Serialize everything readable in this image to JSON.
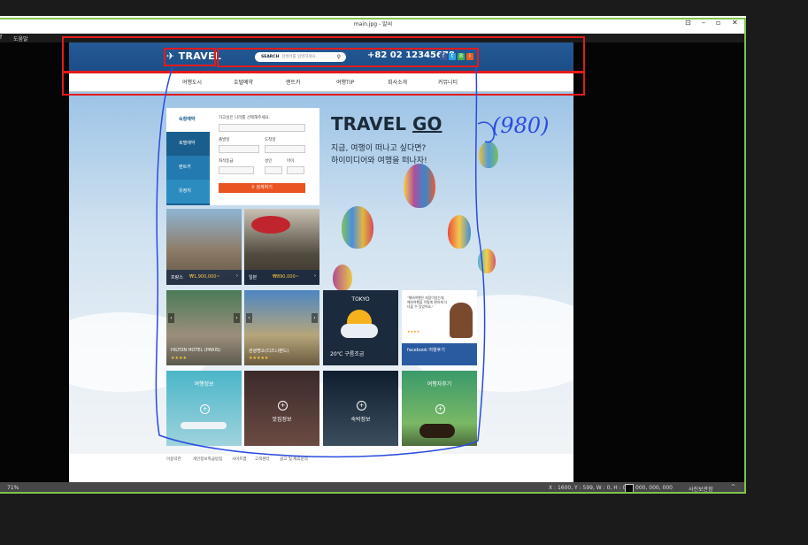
{
  "window": {
    "title": "main.jpg - 알씨",
    "menu_help": "도움말",
    "minimize": "–",
    "maximize": "▫",
    "close": "✕",
    "extra": "⊡"
  },
  "statusbar": {
    "zoom": "71%",
    "coords": "X : 1600, Y : 599, W : 0, H : 0",
    "color_value": "000, 000, 000",
    "right_button": "사진보관함"
  },
  "site": {
    "logo": "TRAVEL",
    "search_label": "SEARCH",
    "search_placeholder": "검색어를 입력하세요.",
    "phone": "+82 02 12345678",
    "nav": [
      "여행도시",
      "호텔예약",
      "렌트카",
      "여행TIP",
      "회사소개",
      "커뮤니티"
    ],
    "booking": {
      "tabs": [
        "숙항예약",
        "호텔예약",
        "렌트카",
        "유정지"
      ],
      "prompt": "가고싶은 나라를 선택해주세요.",
      "depart_label": "출발일",
      "arrive_label": "도착일",
      "seat_label": "좌석등급",
      "adult_label": "성인",
      "child_label": "아이",
      "search_button": "검색하기"
    },
    "promo": {
      "title_a": "TRAVEL",
      "title_b": "GO",
      "line1": "지금, 여행이 떠나고 싶다면?",
      "line2": "하이미디어와 여행을 떠나자!"
    },
    "tiles": {
      "france": {
        "country": "프랑스",
        "price": "₩1,900,000~"
      },
      "japan": {
        "country": "일본",
        "price": "₩890,000~"
      },
      "hotel": {
        "name": "HILTON HOTEL (PARIS)",
        "stars": "★★★★"
      },
      "attraction": {
        "name": "관광명소(디즈니랜드)",
        "stars": "★★★★★"
      },
      "weather": {
        "city": "TOKYO",
        "temp": "20℃ 구름조금"
      },
      "facebook": {
        "quote": "\"해외여행은 처음이었는데, 해외여행을 이렇게 편하게 다녀올 수 있었어요.\"",
        "title": "facebook 여행후기",
        "stars": "★★★★"
      },
      "info1": {
        "title": "여행정보"
      },
      "food": {
        "title": "맛집정보"
      },
      "stay": {
        "title": "숙박정보"
      },
      "review": {
        "title": "여행자후기"
      }
    },
    "footer": {
      "links": [
        "이용약관",
        "개인정보취급방침",
        "사이트맵",
        "고객센터",
        "광고 및 제휴문의"
      ]
    }
  },
  "annotation": {
    "note": "(980)"
  },
  "colors": {
    "header_blue": "#1f5690",
    "accent_orange": "#e95420",
    "frame_green": "#7fc34b",
    "annot_red": "#e31b1b",
    "annot_blue": "#2a4be0"
  }
}
